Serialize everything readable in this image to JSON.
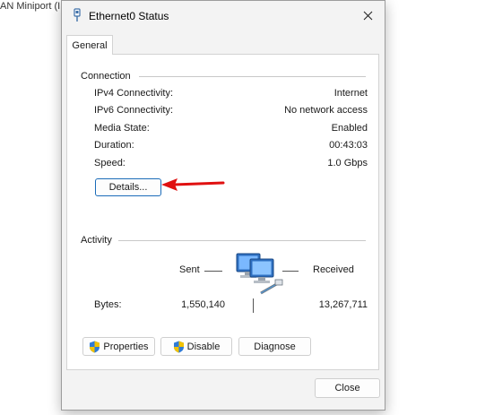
{
  "background": {
    "text": "AN Miniport (I"
  },
  "window": {
    "title": "Ethernet0 Status",
    "close_glyph": "✕"
  },
  "tabs": [
    {
      "label": "General"
    }
  ],
  "connection": {
    "heading": "Connection",
    "rows": [
      {
        "label": "IPv4 Connectivity:",
        "value": "Internet"
      },
      {
        "label": "IPv6 Connectivity:",
        "value": "No network access"
      },
      {
        "label": "Media State:",
        "value": "Enabled"
      },
      {
        "label": "Duration:",
        "value": "00:43:03"
      },
      {
        "label": "Speed:",
        "value": "1.0 Gbps"
      }
    ],
    "details_label": "Details..."
  },
  "activity": {
    "heading": "Activity",
    "sent_label": "Sent",
    "received_label": "Received",
    "bytes_label": "Bytes:",
    "bytes_sent": "1,550,140",
    "bytes_received": "13,267,711"
  },
  "buttons": {
    "properties": "Properties",
    "disable": "Disable",
    "diagnose": "Diagnose",
    "close": "Close"
  },
  "icons": {
    "title": "network-adapter-icon",
    "shield": "uac-shield-icon",
    "network": "network-computers-icon",
    "annotation": "red-arrow-icon"
  },
  "colors": {
    "focus_border": "#1a6bb8",
    "annotation_arrow": "#e01010"
  }
}
